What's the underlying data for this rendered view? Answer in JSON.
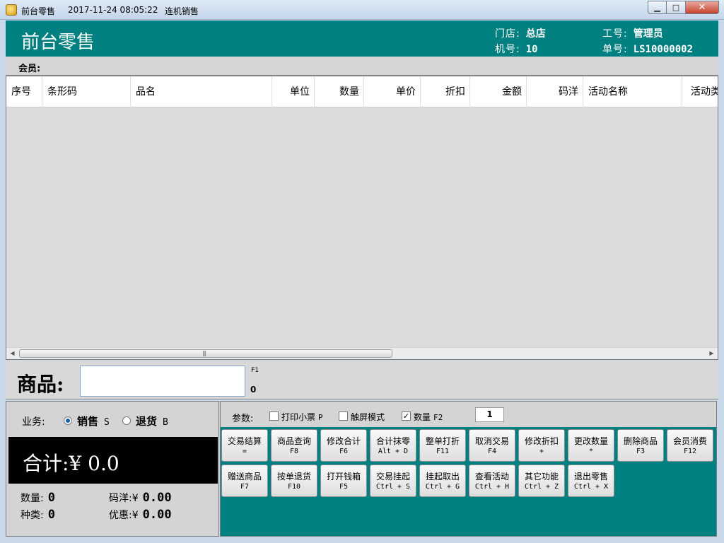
{
  "window": {
    "title": "前台零售",
    "datetime": "2017-11-24 08:05:22",
    "mode": "连机销售",
    "min_label": "▁",
    "max_label": "□",
    "close_label": "✕"
  },
  "header": {
    "title": "前台零售",
    "store_label": "门店:",
    "store": "总店",
    "operator_label": "工号:",
    "operator": "管理员",
    "machine_label": "机号:",
    "machine": "10",
    "order_label": "单号:",
    "order": "LS10000002"
  },
  "member": {
    "label": "会员:"
  },
  "grid": {
    "columns": [
      "序号",
      "条形码",
      "品名",
      "单位",
      "数量",
      "单价",
      "折扣",
      "金额",
      "码洋",
      "活动名称",
      "活动类"
    ],
    "scroll_left": "◀",
    "scroll_right": "▶",
    "grip": "|||"
  },
  "product": {
    "label": "商品:",
    "hotkey": "F1",
    "value": "",
    "count": "0"
  },
  "business": {
    "label": "业务:",
    "sale": "销售",
    "sale_key": "S",
    "return": "退货",
    "return_key": "B",
    "selected": "sale"
  },
  "total": {
    "label": "合计:¥ 0.0"
  },
  "stats": {
    "qty_label": "数量:",
    "qty": "0",
    "kinds_label": "种类:",
    "kinds": "0",
    "list_price_label": "码洋:¥",
    "list_price": "0.00",
    "discount_label": "优惠:¥",
    "discount": "0.00"
  },
  "params": {
    "label": "参数:",
    "print_receipt": "打印小票",
    "print_receipt_key": "P",
    "print_receipt_checked": false,
    "touch_mode": "触屏模式",
    "touch_mode_checked": false,
    "quantity": "数量",
    "quantity_key": "F2",
    "quantity_checked": true,
    "quantity_value": "1",
    "check_mark": "✓"
  },
  "functions": [
    {
      "name": "交易结算",
      "key": "="
    },
    {
      "name": "商品查询",
      "key": "F8"
    },
    {
      "name": "修改合计",
      "key": "F6"
    },
    {
      "name": "合计抹零",
      "key": "Alt + D"
    },
    {
      "name": "整单打折",
      "key": "F11"
    },
    {
      "name": "取消交易",
      "key": "F4"
    },
    {
      "name": "修改折扣",
      "key": "+"
    },
    {
      "name": "更改数量",
      "key": "*"
    },
    {
      "name": "删除商品",
      "key": "F3"
    },
    {
      "name": "会员消费",
      "key": "F12"
    },
    {
      "name": "赠送商品",
      "key": "F7"
    },
    {
      "name": "按单退货",
      "key": "F10"
    },
    {
      "name": "打开钱箱",
      "key": "F5"
    },
    {
      "name": "交易挂起",
      "key": "Ctrl + S"
    },
    {
      "name": "挂起取出",
      "key": "Ctrl + G"
    },
    {
      "name": "查看活动",
      "key": "Ctrl + H"
    },
    {
      "name": "其它功能",
      "key": "Ctrl + Z"
    },
    {
      "name": "退出零售",
      "key": "Ctrl + X"
    }
  ]
}
